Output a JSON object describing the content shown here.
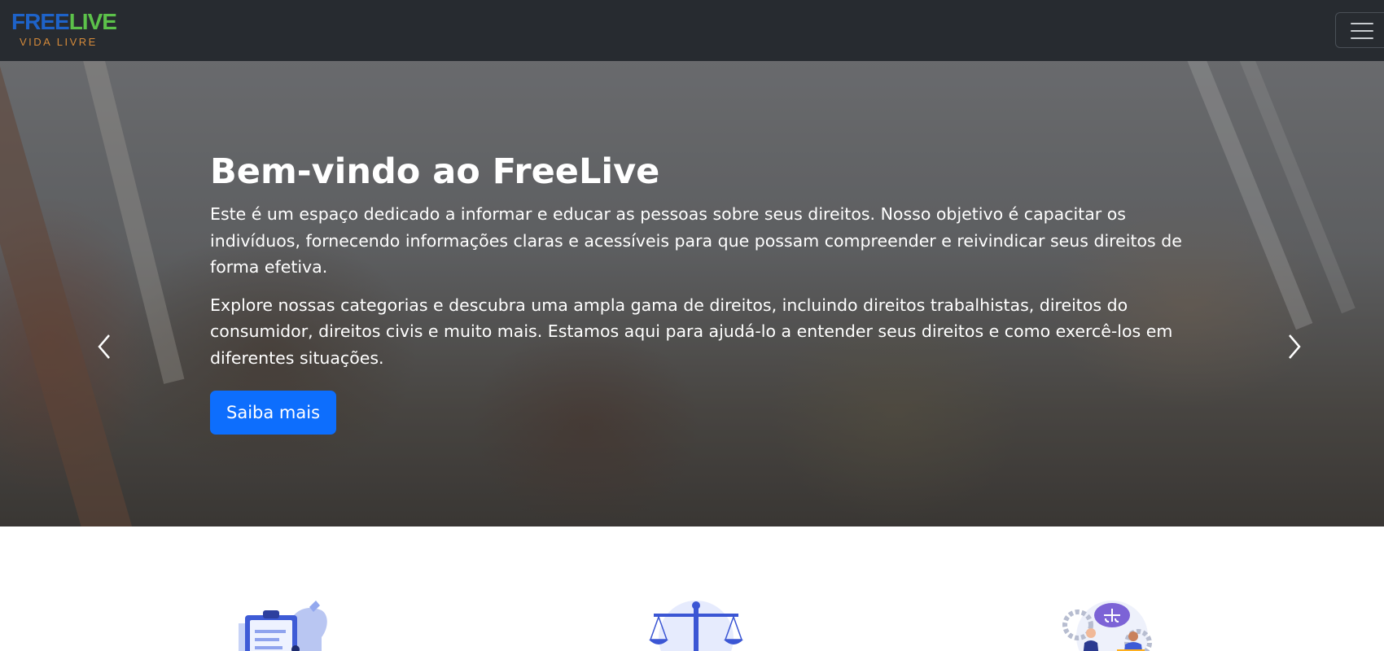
{
  "navbar": {
    "logo_top_free": "FREE",
    "logo_top_live": "LIVE",
    "logo_sub": "VIDA LIVRE",
    "menu_icon": "hamburger-menu-icon"
  },
  "hero": {
    "title": "Bem-vindo ao FreeLive",
    "paragraph_1": "Este é um espaço dedicado a informar e educar as pessoas sobre seus direitos. Nosso objetivo é capacitar os indivíduos, fornecendo informações claras e acessíveis para que possam compreender e reivindicar seus direitos de forma efetiva.",
    "paragraph_2": "Explore nossas categorias e descubra uma ampla gama de direitos, incluindo direitos trabalhistas, direitos do consumidor, direitos civis e muito mais. Estamos aqui para ajudá-lo a entender seus direitos e como exercê-los em diferentes situações.",
    "button_label": "Saiba mais",
    "prev_icon": "chevron-left-icon",
    "next_icon": "chevron-right-icon",
    "slides_count": 3,
    "active_slide": 1
  },
  "features": [
    {
      "icon": "clipboard-protest-illustration"
    },
    {
      "icon": "justice-scale-illustration"
    },
    {
      "icon": "law-gears-illustration"
    }
  ],
  "colors": {
    "navbar_bg": "#272b30",
    "primary_button": "#0d6efd",
    "logo_blue": "#1e63c9",
    "logo_green": "#5cc24a",
    "logo_orange": "#d48a3a"
  }
}
